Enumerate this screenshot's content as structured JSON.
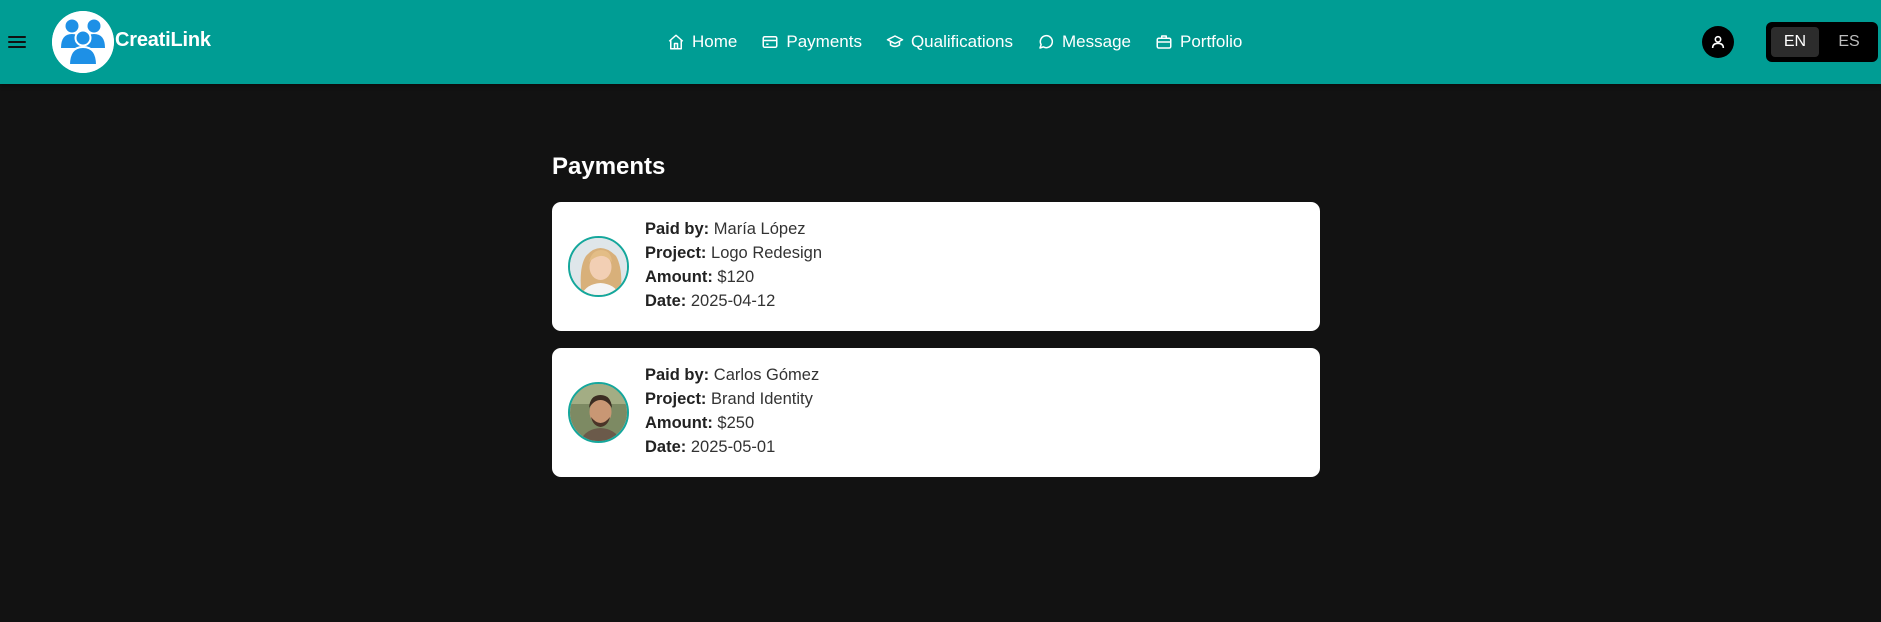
{
  "header": {
    "brand": "CreatiLink",
    "nav": [
      {
        "label": "Home",
        "icon": "home-icon"
      },
      {
        "label": "Payments",
        "icon": "credit-card-icon"
      },
      {
        "label": "Qualifications",
        "icon": "graduation-cap-icon"
      },
      {
        "label": "Message",
        "icon": "chat-bubble-icon"
      },
      {
        "label": "Portfolio",
        "icon": "briefcase-icon"
      }
    ],
    "languages": [
      {
        "label": "EN",
        "active": true
      },
      {
        "label": "ES",
        "active": false
      }
    ]
  },
  "main": {
    "title": "Payments",
    "field_labels": {
      "paid_by": "Paid by:",
      "project": "Project:",
      "amount": "Amount:",
      "date": "Date:"
    },
    "payments": [
      {
        "paid_by": "María López",
        "project": "Logo Redesign",
        "amount": "$120",
        "date": "2025-04-12"
      },
      {
        "paid_by": "Carlos Gómez",
        "project": "Brand Identity",
        "amount": "$250",
        "date": "2025-05-01"
      }
    ]
  },
  "colors": {
    "header_bg": "#009d94",
    "page_bg": "#121212",
    "card_bg": "#ffffff",
    "avatar_border": "#15a79c"
  }
}
